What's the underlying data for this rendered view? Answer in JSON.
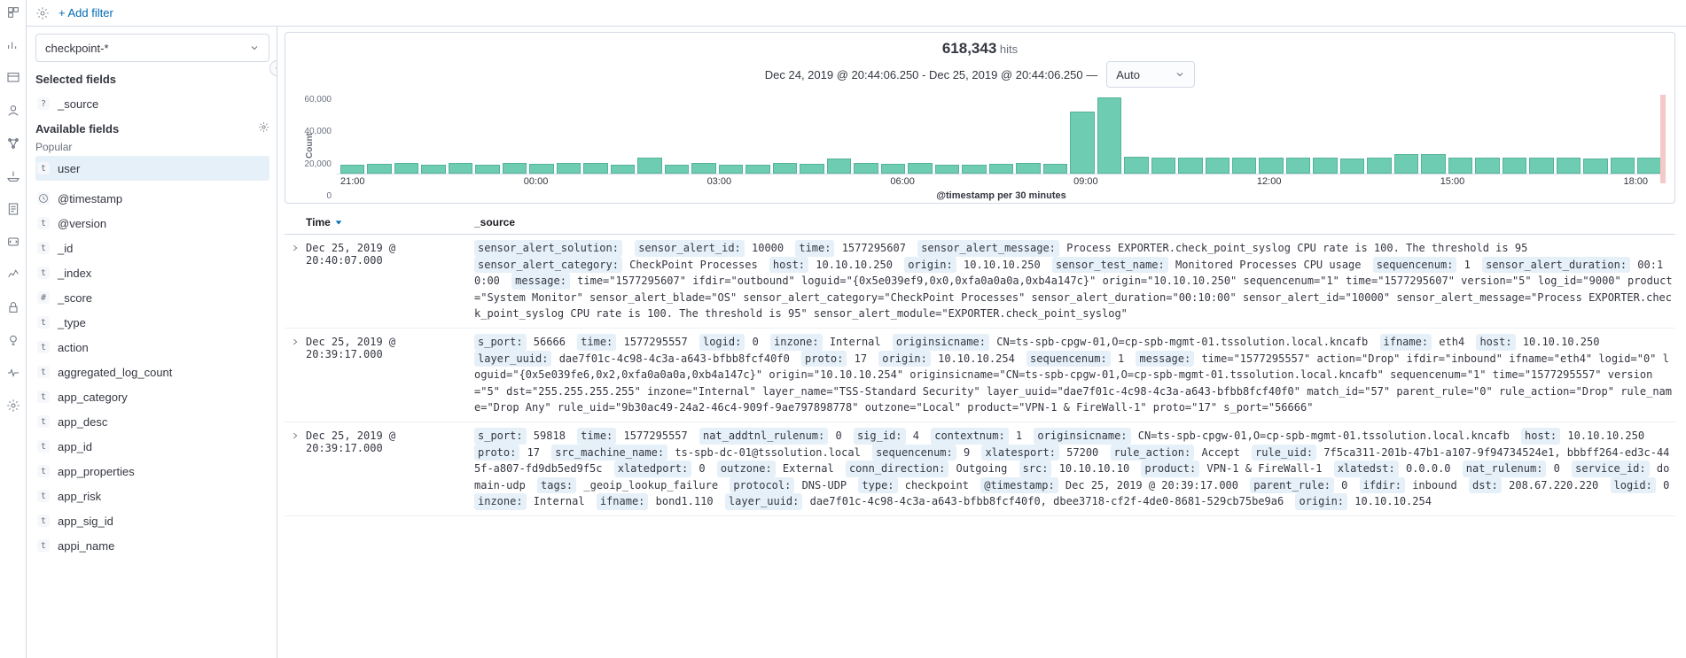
{
  "header": {
    "add_filter": "+ Add filter"
  },
  "sidebar": {
    "index_pattern": "checkpoint-*",
    "selected_title": "Selected fields",
    "available_title": "Available fields",
    "popular_title": "Popular",
    "selected": [
      {
        "type": "?",
        "name": "_source"
      }
    ],
    "popular": [
      {
        "type": "t",
        "name": "user"
      }
    ],
    "fields": [
      {
        "type": "clock",
        "name": "@timestamp"
      },
      {
        "type": "t",
        "name": "@version"
      },
      {
        "type": "t",
        "name": "_id"
      },
      {
        "type": "t",
        "name": "_index"
      },
      {
        "type": "#",
        "name": "_score"
      },
      {
        "type": "t",
        "name": "_type"
      },
      {
        "type": "t",
        "name": "action"
      },
      {
        "type": "t",
        "name": "aggregated_log_count"
      },
      {
        "type": "t",
        "name": "app_category"
      },
      {
        "type": "t",
        "name": "app_desc"
      },
      {
        "type": "t",
        "name": "app_id"
      },
      {
        "type": "t",
        "name": "app_properties"
      },
      {
        "type": "t",
        "name": "app_risk"
      },
      {
        "type": "t",
        "name": "app_sig_id"
      },
      {
        "type": "t",
        "name": "appi_name"
      }
    ]
  },
  "chart": {
    "hits": "618,343",
    "hits_label": "hits",
    "date_range": "Dec 24, 2019 @ 20:44:06.250 - Dec 25, 2019 @ 20:44:06.250 —",
    "interval": "Auto",
    "y_label": "Count",
    "x_label": "@timestamp per 30 minutes",
    "y_ticks": [
      "60,000",
      "40,000",
      "20,000",
      "0"
    ],
    "x_ticks": [
      "21:00",
      "00:00",
      "03:00",
      "06:00",
      "09:00",
      "12:00",
      "15:00",
      "18:00"
    ]
  },
  "chart_data": {
    "type": "bar",
    "title": "618,343 hits",
    "xlabel": "@timestamp per 30 minutes",
    "ylabel": "Count",
    "ylim": [
      0,
      70000
    ],
    "categories": [
      "20:30",
      "21:00",
      "21:30",
      "22:00",
      "22:30",
      "23:00",
      "23:30",
      "00:00",
      "00:30",
      "01:00",
      "01:30",
      "02:00",
      "02:30",
      "03:00",
      "03:30",
      "04:00",
      "04:30",
      "05:00",
      "05:30",
      "06:00",
      "06:30",
      "07:00",
      "07:30",
      "08:00",
      "08:30",
      "09:00",
      "09:30",
      "10:00",
      "10:30",
      "11:00",
      "11:30",
      "12:00",
      "12:30",
      "13:00",
      "13:30",
      "14:00",
      "14:30",
      "15:00",
      "15:30",
      "16:00",
      "16:30",
      "17:00",
      "17:30",
      "18:00",
      "18:30",
      "19:00",
      "19:30",
      "20:00",
      "20:30"
    ],
    "values": [
      8000,
      8500,
      9000,
      8000,
      9000,
      8000,
      9000,
      8500,
      9000,
      9000,
      8000,
      14000,
      8000,
      9000,
      8000,
      8000,
      9000,
      8500,
      13000,
      9000,
      8500,
      9500,
      8000,
      8000,
      8500,
      9000,
      8500,
      55000,
      68000,
      15000,
      14000,
      14000,
      14000,
      14000,
      14000,
      14000,
      14000,
      13500,
      14000,
      17000,
      17000,
      14000,
      14000,
      14000,
      14000,
      14000,
      13500,
      14000,
      14000
    ]
  },
  "table": {
    "headers": {
      "time": "Time",
      "source": "_source"
    },
    "rows": [
      {
        "time": "Dec 25, 2019 @ 20:40:07.000",
        "tagged": [
          {
            "k": "sensor_alert_solution:",
            "v": ""
          },
          {
            "k": "sensor_alert_id:",
            "v": "10000"
          },
          {
            "k": "time:",
            "v": "1577295607"
          },
          {
            "k": "sensor_alert_message:",
            "v": "Process EXPORTER.check_point_syslog CPU rate is 100. The threshold is 95"
          },
          {
            "k": "sensor_alert_category:",
            "v": "CheckPoint Processes"
          },
          {
            "k": "host:",
            "v": "10.10.10.250"
          },
          {
            "k": "origin:",
            "v": "10.10.10.250"
          },
          {
            "k": "sensor_test_name:",
            "v": "Monitored Processes CPU usage"
          },
          {
            "k": "sequencenum:",
            "v": "1"
          },
          {
            "k": "sensor_alert_duration:",
            "v": "00:10:00"
          },
          {
            "k": "message:",
            "v": "time=\"1577295607\" ifdir=\"outbound\" loguid=\"{0x5e039ef9,0x0,0xfa0a0a0a,0xb4a147c}\" origin=\"10.10.10.250\" sequencenum=\"1\" time=\"1577295607\" version=\"5\" log_id=\"9000\" product=\"System Monitor\" sensor_alert_blade=\"OS\" sensor_alert_category=\"CheckPoint Processes\" sensor_alert_duration=\"00:10:00\" sensor_alert_id=\"10000\" sensor_alert_message=\"Process EXPORTER.check_point_syslog CPU rate is 100. The threshold is 95\" sensor_alert_module=\"EXPORTER.check_point_syslog\""
          }
        ]
      },
      {
        "time": "Dec 25, 2019 @ 20:39:17.000",
        "tagged": [
          {
            "k": "s_port:",
            "v": "56666"
          },
          {
            "k": "time:",
            "v": "1577295557"
          },
          {
            "k": "logid:",
            "v": "0"
          },
          {
            "k": "inzone:",
            "v": "Internal"
          },
          {
            "k": "originsicname:",
            "v": "CN=ts-spb-cpgw-01,O=cp-spb-mgmt-01.tssolution.local.kncafb"
          },
          {
            "k": "ifname:",
            "v": "eth4"
          },
          {
            "k": "host:",
            "v": "10.10.10.250"
          },
          {
            "k": "layer_uuid:",
            "v": "dae7f01c-4c98-4c3a-a643-bfbb8fcf40f0"
          },
          {
            "k": "proto:",
            "v": "17"
          },
          {
            "k": "origin:",
            "v": "10.10.10.254"
          },
          {
            "k": "sequencenum:",
            "v": "1"
          },
          {
            "k": "message:",
            "v": "time=\"1577295557\" action=\"Drop\" ifdir=\"inbound\" ifname=\"eth4\" logid=\"0\" loguid=\"{0x5e039fe6,0x2,0xfa0a0a0a,0xb4a147c}\" origin=\"10.10.10.254\" originsicname=\"CN=ts-spb-cpgw-01,O=cp-spb-mgmt-01.tssolution.local.kncafb\" sequencenum=\"1\" time=\"1577295557\" version=\"5\" dst=\"255.255.255.255\" inzone=\"Internal\" layer_name=\"TSS-Standard Security\" layer_uuid=\"dae7f01c-4c98-4c3a-a643-bfbb8fcf40f0\" match_id=\"57\" parent_rule=\"0\" rule_action=\"Drop\" rule_name=\"Drop Any\" rule_uid=\"9b30ac49-24a2-46c4-909f-9ae797898778\" outzone=\"Local\" product=\"VPN-1 & FireWall-1\" proto=\"17\" s_port=\"56666\""
          }
        ]
      },
      {
        "time": "Dec 25, 2019 @ 20:39:17.000",
        "tagged": [
          {
            "k": "s_port:",
            "v": "59818"
          },
          {
            "k": "time:",
            "v": "1577295557"
          },
          {
            "k": "nat_addtnl_rulenum:",
            "v": "0"
          },
          {
            "k": "sig_id:",
            "v": "4"
          },
          {
            "k": "contextnum:",
            "v": "1"
          },
          {
            "k": "originsicname:",
            "v": "CN=ts-spb-cpgw-01,O=cp-spb-mgmt-01.tssolution.local.kncafb"
          },
          {
            "k": "host:",
            "v": "10.10.10.250"
          },
          {
            "k": "proto:",
            "v": "17"
          },
          {
            "k": "src_machine_name:",
            "v": "ts-spb-dc-01@tssolution.local"
          },
          {
            "k": "sequencenum:",
            "v": "9"
          },
          {
            "k": "xlatesport:",
            "v": "57200"
          },
          {
            "k": "rule_action:",
            "v": "Accept"
          },
          {
            "k": "rule_uid:",
            "v": "7f5ca311-201b-47b1-a107-9f94734524e1, bbbff264-ed3c-445f-a807-fd9db5ed9f5c"
          },
          {
            "k": "xlatedport:",
            "v": "0"
          },
          {
            "k": "outzone:",
            "v": "External"
          },
          {
            "k": "conn_direction:",
            "v": "Outgoing"
          },
          {
            "k": "src:",
            "v": "10.10.10.10"
          },
          {
            "k": "product:",
            "v": "VPN-1 & FireWall-1"
          },
          {
            "k": "xlatedst:",
            "v": "0.0.0.0"
          },
          {
            "k": "nat_rulenum:",
            "v": "0"
          },
          {
            "k": "service_id:",
            "v": "domain-udp"
          },
          {
            "k": "tags:",
            "v": "_geoip_lookup_failure"
          },
          {
            "k": "protocol:",
            "v": "DNS-UDP"
          },
          {
            "k": "type:",
            "v": "checkpoint"
          },
          {
            "k": "@timestamp:",
            "v": "Dec 25, 2019 @ 20:39:17.000"
          },
          {
            "k": "parent_rule:",
            "v": "0"
          },
          {
            "k": "ifdir:",
            "v": "inbound"
          },
          {
            "k": "dst:",
            "v": "208.67.220.220"
          },
          {
            "k": "logid:",
            "v": "0"
          },
          {
            "k": "inzone:",
            "v": "Internal"
          },
          {
            "k": "ifname:",
            "v": "bond1.110"
          },
          {
            "k": "layer_uuid:",
            "v": "dae7f01c-4c98-4c3a-a643-bfbb8fcf40f0, dbee3718-cf2f-4de0-8681-529cb75be9a6"
          },
          {
            "k": "origin:",
            "v": "10.10.10.254"
          }
        ]
      }
    ]
  }
}
